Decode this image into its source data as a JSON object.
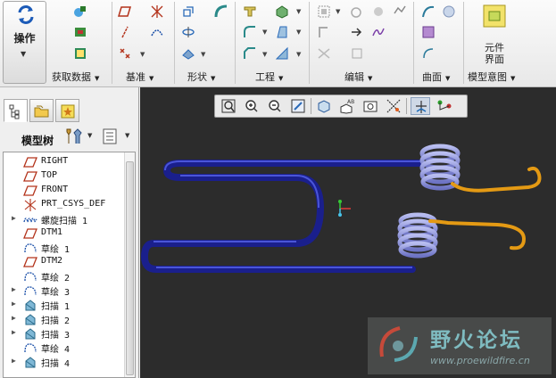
{
  "ribbon": {
    "operations_label": "操作",
    "groups": [
      {
        "label": "获取数据"
      },
      {
        "label": "基准"
      },
      {
        "label": "形状"
      },
      {
        "label": "工程"
      },
      {
        "label": "编辑"
      },
      {
        "label": "曲面"
      },
      {
        "label": "模型意图"
      }
    ],
    "component_interface": {
      "line1": "元件",
      "line2": "界面"
    }
  },
  "left_panel": {
    "tabs": [
      "model-tree-tab",
      "layer-tree-tab",
      "favorites-tab"
    ],
    "title": "模型树",
    "tree_items": [
      {
        "label": "RIGHT",
        "icon": "datum-plane-icon",
        "expandable": false
      },
      {
        "label": "TOP",
        "icon": "datum-plane-icon",
        "expandable": false
      },
      {
        "label": "FRONT",
        "icon": "datum-plane-icon",
        "expandable": false
      },
      {
        "label": "PRT_CSYS_DEF",
        "icon": "csys-icon",
        "expandable": false
      },
      {
        "label": "螺旋扫描 1",
        "icon": "helical-sweep-icon",
        "expandable": true
      },
      {
        "label": "DTM1",
        "icon": "datum-plane-icon",
        "expandable": false
      },
      {
        "label": "草绘 1",
        "icon": "sketch-icon",
        "expandable": false
      },
      {
        "label": "DTM2",
        "icon": "datum-plane-icon",
        "expandable": false
      },
      {
        "label": "草绘 2",
        "icon": "sketch-icon",
        "expandable": false
      },
      {
        "label": "草绘 3",
        "icon": "sketch-icon",
        "expandable": true
      },
      {
        "label": "扫描 1",
        "icon": "sweep-icon",
        "expandable": true
      },
      {
        "label": "扫描 2",
        "icon": "sweep-icon",
        "expandable": true
      },
      {
        "label": "扫描 3",
        "icon": "sweep-icon",
        "expandable": true
      },
      {
        "label": "草绘 4",
        "icon": "sketch-icon",
        "expandable": false
      },
      {
        "label": "扫描 4",
        "icon": "sweep-icon",
        "expandable": true
      }
    ]
  },
  "viewport": {
    "background_color": "#2c2c2c",
    "wire_color": "#1a1f8c",
    "spring_color": "#8f95d6",
    "hook_color": "#e49a14"
  },
  "watermark": {
    "title": "野火论坛",
    "url": "www.proewildfire.cn"
  }
}
